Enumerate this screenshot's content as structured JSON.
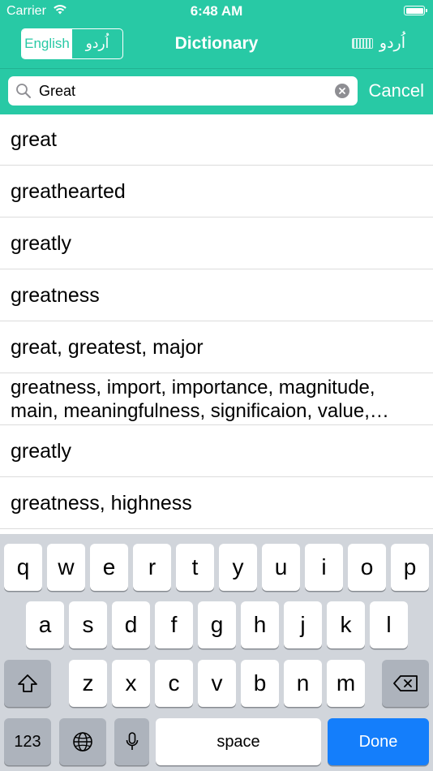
{
  "status_bar": {
    "carrier": "Carrier",
    "time": "6:48 AM",
    "icons": [
      "wifi-icon",
      "battery-icon"
    ]
  },
  "nav": {
    "segments": [
      {
        "label": "English",
        "selected": true
      },
      {
        "label": "اُردو",
        "selected": false
      }
    ],
    "title": "Dictionary",
    "keyboard_label": "اُردو",
    "keyboard_icon": "keyboard-icon"
  },
  "search": {
    "value": "Great",
    "placeholder": "",
    "cancel_label": "Cancel",
    "icons": [
      "search-icon",
      "clear-icon"
    ]
  },
  "results": [
    "great",
    "greathearted",
    "greatly",
    "greatness",
    "great, greatest, major",
    "greatness, import, importance, magnitude, main, meaningfulness, significaion, value, worth",
    "greatly",
    "greatness, highness"
  ],
  "keyboard": {
    "row1": [
      "q",
      "w",
      "e",
      "r",
      "t",
      "y",
      "u",
      "i",
      "o",
      "p"
    ],
    "row2": [
      "a",
      "s",
      "d",
      "f",
      "g",
      "h",
      "j",
      "k",
      "l"
    ],
    "row3": [
      "z",
      "x",
      "c",
      "v",
      "b",
      "n",
      "m"
    ],
    "numbers_label": "123",
    "space_label": "space",
    "done_label": "Done",
    "icons": [
      "shift-icon",
      "backspace-icon",
      "globe-icon",
      "microphone-icon"
    ]
  },
  "colors": {
    "accent": "#28c9a5",
    "done_key": "#147efb",
    "keyboard_bg": "#d1d5db"
  }
}
